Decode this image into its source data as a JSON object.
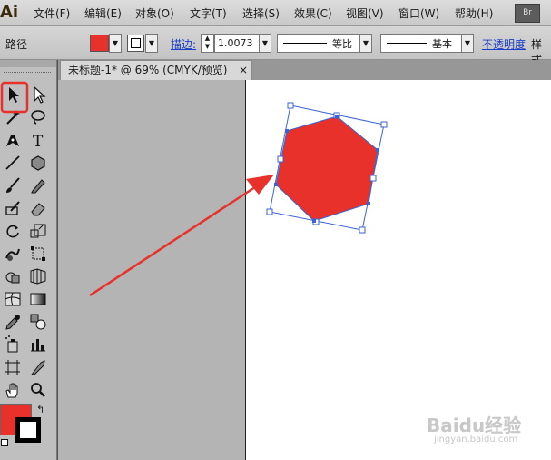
{
  "app": {
    "logo_text": "Ai"
  },
  "menu": {
    "items": [
      "文件(F)",
      "编辑(E)",
      "对象(O)",
      "文字(T)",
      "选择(S)",
      "效果(C)",
      "视图(V)",
      "窗口(W)",
      "帮助(H)"
    ],
    "bridge_label": "Br"
  },
  "control_bar": {
    "selection_label": "路径",
    "fill_color": "#e8312a",
    "stroke_label": "描边:",
    "stroke_weight": "1.0073",
    "profile_label": "等比",
    "brush_label": "基本",
    "opacity_label": "不透明度",
    "style_label": "样式"
  },
  "document": {
    "tab_title": "未标题-1* @ 69% (CMYK/预览)",
    "close_glyph": "×"
  },
  "tools": [
    {
      "name": "selection-tool-icon"
    },
    {
      "name": "direct-selection-tool-icon"
    },
    {
      "name": "magic-wand-tool-icon"
    },
    {
      "name": "lasso-tool-icon"
    },
    {
      "name": "pen-tool-icon"
    },
    {
      "name": "type-tool-icon",
      "glyph": "T"
    },
    {
      "name": "line-tool-icon"
    },
    {
      "name": "polygon-tool-icon"
    },
    {
      "name": "paintbrush-tool-icon"
    },
    {
      "name": "pencil-tool-icon"
    },
    {
      "name": "blob-brush-tool-icon"
    },
    {
      "name": "eraser-tool-icon"
    },
    {
      "name": "rotate-tool-icon"
    },
    {
      "name": "scale-tool-icon"
    },
    {
      "name": "warp-tool-icon"
    },
    {
      "name": "free-transform-tool-icon"
    },
    {
      "name": "shape-builder-tool-icon"
    },
    {
      "name": "perspective-grid-tool-icon"
    },
    {
      "name": "mesh-tool-icon"
    },
    {
      "name": "gradient-tool-icon"
    },
    {
      "name": "eyedropper-tool-icon"
    },
    {
      "name": "blend-tool-icon"
    },
    {
      "name": "symbol-sprayer-tool-icon"
    },
    {
      "name": "column-graph-tool-icon"
    },
    {
      "name": "artboard-tool-icon"
    },
    {
      "name": "slice-tool-icon"
    },
    {
      "name": "hand-tool-icon"
    },
    {
      "name": "zoom-tool-icon"
    }
  ],
  "colors": {
    "fill": "#e8312a",
    "stroke": "#000000",
    "highlight": "#e8312a",
    "selection_blue": "#3a63d4"
  },
  "watermark": {
    "main": "Baidu经验",
    "sub": "jingyan.baidu.com"
  }
}
